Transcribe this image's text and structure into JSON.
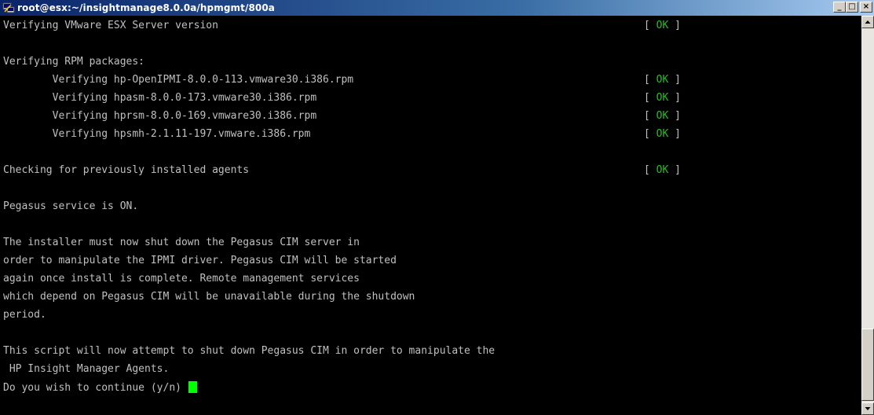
{
  "window": {
    "title": "root@esx:~/insightmanage8.0.0a/hpmgmt/800a",
    "icon": "putty-icon",
    "buttons": {
      "minimize": "_",
      "maximize": "□",
      "close": "×"
    }
  },
  "terminal": {
    "colors": {
      "background": "#000000",
      "text": "#c0c0c0",
      "ok": "#22c022",
      "cursor": "#00ff00"
    },
    "lines": [
      "Verifying VMware ESX Server version",
      "",
      "Verifying RPM packages:",
      "        Verifying hp-OpenIPMI-8.0.0-113.vmware30.i386.rpm",
      "        Verifying hpasm-8.0.0-173.vmware30.i386.rpm",
      "        Verifying hprsm-8.0.0-169.vmware30.i386.rpm",
      "        Verifying hpsmh-2.1.11-197.vmware.i386.rpm",
      "",
      "Checking for previously installed agents",
      "",
      "Pegasus service is ON.",
      "",
      "The installer must now shut down the Pegasus CIM server in",
      "order to manipulate the IPMI driver. Pegasus CIM will be started",
      "again once install is complete. Remote management services",
      "which depend on Pegasus CIM will be unavailable during the shutdown",
      "period.",
      "",
      "This script will now attempt to shut down Pegasus CIM in order to manipulate the",
      " HP Insight Manager Agents.",
      "Do you wish to continue (y/n) "
    ],
    "status_open": "[ ",
    "status_ok": "OK",
    "status_close": " ]"
  }
}
